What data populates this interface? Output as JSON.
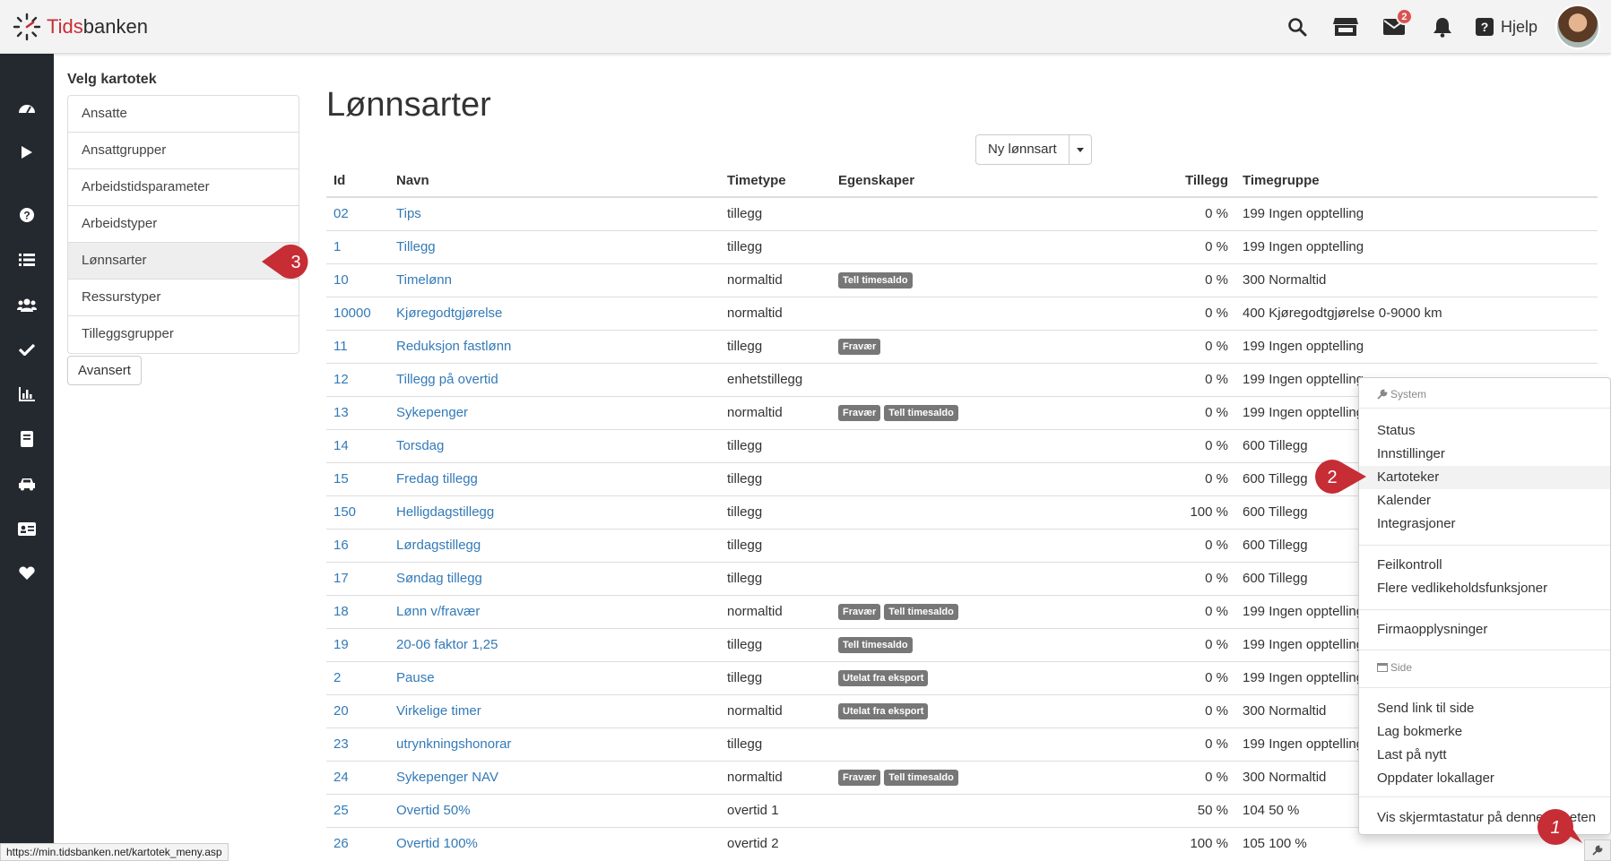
{
  "app": {
    "brand_a": "Tids",
    "brand_b": "banken",
    "help_label": "Hjelp",
    "mail_badge": "2"
  },
  "sidebar_icons": [
    "dashboard-icon",
    "play-icon",
    "question-icon",
    "list-icon",
    "users-icon",
    "check-icon",
    "chart-icon",
    "book-icon",
    "car-icon",
    "id-card-icon",
    "heart-icon"
  ],
  "kartotek": {
    "title": "Velg kartotek",
    "items": [
      "Ansatte",
      "Ansattgrupper",
      "Arbeidstidsparameter",
      "Arbeidstyper",
      "Lønnsarter",
      "Ressurstyper",
      "Tilleggsgrupper"
    ],
    "active": "Lønnsarter",
    "advanced_label": "Avansert"
  },
  "main": {
    "title": "Lønnsarter",
    "new_button": "Ny lønnsart",
    "columns": [
      "Id",
      "Navn",
      "Timetype",
      "Egenskaper",
      "Tillegg",
      "Timegruppe"
    ],
    "rows": [
      {
        "id": "02",
        "name": "Tips",
        "timetype": "tillegg",
        "props": [],
        "tillegg": "0 %",
        "group": "199 Ingen opptelling"
      },
      {
        "id": "1",
        "name": "Tillegg",
        "timetype": "tillegg",
        "props": [],
        "tillegg": "0 %",
        "group": "199 Ingen opptelling"
      },
      {
        "id": "10",
        "name": "Timelønn",
        "timetype": "normaltid",
        "props": [
          "Tell timesaldo"
        ],
        "tillegg": "0 %",
        "group": "300 Normaltid"
      },
      {
        "id": "10000",
        "name": "Kjøregodtgjørelse",
        "timetype": "normaltid",
        "props": [],
        "tillegg": "0 %",
        "group": "400 Kjøregodtgjørelse 0-9000 km"
      },
      {
        "id": "11",
        "name": "Reduksjon fastlønn",
        "timetype": "tillegg",
        "props": [
          "Fravær"
        ],
        "tillegg": "0 %",
        "group": "199 Ingen opptelling"
      },
      {
        "id": "12",
        "name": "Tillegg på overtid",
        "timetype": "enhetstillegg",
        "props": [],
        "tillegg": "0 %",
        "group": "199 Ingen opptelling"
      },
      {
        "id": "13",
        "name": "Sykepenger",
        "timetype": "normaltid",
        "props": [
          "Fravær",
          "Tell timesaldo"
        ],
        "tillegg": "0 %",
        "group": "199 Ingen opptelling"
      },
      {
        "id": "14",
        "name": "Torsdag",
        "timetype": "tillegg",
        "props": [],
        "tillegg": "0 %",
        "group": "600 Tillegg"
      },
      {
        "id": "15",
        "name": "Fredag tillegg",
        "timetype": "tillegg",
        "props": [],
        "tillegg": "0 %",
        "group": "600 Tillegg"
      },
      {
        "id": "150",
        "name": "Helligdagstillegg",
        "timetype": "tillegg",
        "props": [],
        "tillegg": "100 %",
        "group": "600 Tillegg"
      },
      {
        "id": "16",
        "name": "Lørdagstillegg",
        "timetype": "tillegg",
        "props": [],
        "tillegg": "0 %",
        "group": "600 Tillegg"
      },
      {
        "id": "17",
        "name": "Søndag tillegg",
        "timetype": "tillegg",
        "props": [],
        "tillegg": "0 %",
        "group": "600 Tillegg"
      },
      {
        "id": "18",
        "name": "Lønn v/fravær",
        "timetype": "normaltid",
        "props": [
          "Fravær",
          "Tell timesaldo"
        ],
        "tillegg": "0 %",
        "group": "199 Ingen opptelling"
      },
      {
        "id": "19",
        "name": "20-06 faktor 1,25",
        "timetype": "tillegg",
        "props": [
          "Tell timesaldo"
        ],
        "tillegg": "0 %",
        "group": "199 Ingen opptelling"
      },
      {
        "id": "2",
        "name": "Pause",
        "timetype": "tillegg",
        "props": [
          "Utelat fra eksport"
        ],
        "tillegg": "0 %",
        "group": "199 Ingen opptelling"
      },
      {
        "id": "20",
        "name": "Virkelige timer",
        "timetype": "normaltid",
        "props": [
          "Utelat fra eksport"
        ],
        "tillegg": "0 %",
        "group": "300 Normaltid"
      },
      {
        "id": "23",
        "name": "utrynkningshonorar",
        "timetype": "tillegg",
        "props": [],
        "tillegg": "0 %",
        "group": "199 Ingen opptelling"
      },
      {
        "id": "24",
        "name": "Sykepenger NAV",
        "timetype": "normaltid",
        "props": [
          "Fravær",
          "Tell timesaldo"
        ],
        "tillegg": "0 %",
        "group": "300 Normaltid"
      },
      {
        "id": "25",
        "name": "Overtid 50%",
        "timetype": "overtid 1",
        "props": [],
        "tillegg": "50 %",
        "group": "104 50 %"
      },
      {
        "id": "26",
        "name": "Overtid 100%",
        "timetype": "overtid 2",
        "props": [],
        "tillegg": "100 %",
        "group": "105 100 %"
      }
    ]
  },
  "system_menu": {
    "header_system": "System",
    "items_a": [
      "Status",
      "Innstillinger",
      "Kartoteker",
      "Kalender",
      "Integrasjoner"
    ],
    "highlighted": "Kartoteker",
    "items_b": [
      "Feilkontroll",
      "Flere vedlikeholdsfunksjoner"
    ],
    "items_c": [
      "Firmaopplysninger"
    ],
    "header_side": "Side",
    "items_d": [
      "Send link til side",
      "Lag bokmerke",
      "Last på nytt",
      "Oppdater lokallager"
    ],
    "items_e": [
      "Vis skjermtastatur på denne enheten"
    ]
  },
  "callouts": {
    "one": "1",
    "two": "2",
    "three": "3"
  },
  "status_url": "https://min.tidsbanken.net/kartotek_meny.asp",
  "colors": {
    "link": "#337ab7",
    "sidebar": "#24292f",
    "callout": "#c62d35",
    "label": "#777777"
  }
}
